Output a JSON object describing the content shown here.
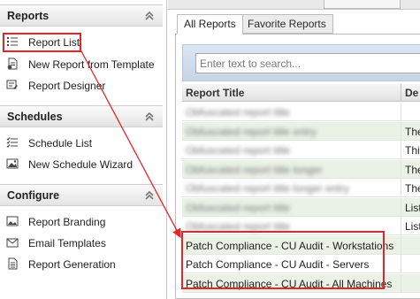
{
  "nav": {
    "sections": [
      {
        "title": "Reports",
        "items": [
          {
            "label": "Report List",
            "icon": "list-icon",
            "selected": true
          },
          {
            "label": "New Report from Template",
            "icon": "new-document-icon"
          },
          {
            "label": "Report Designer",
            "icon": "designer-icon"
          }
        ]
      },
      {
        "title": "Schedules",
        "items": [
          {
            "label": "Schedule List",
            "icon": "checklist-icon"
          },
          {
            "label": "New Schedule Wizard",
            "icon": "image-wizard-icon"
          }
        ]
      },
      {
        "title": "Configure",
        "items": [
          {
            "label": "Report Branding",
            "icon": "image-icon"
          },
          {
            "label": "Email Templates",
            "icon": "envelope-icon"
          },
          {
            "label": "Report Generation",
            "icon": "document-icon"
          }
        ]
      }
    ]
  },
  "tabs": [
    "All Reports",
    "Favorite Reports"
  ],
  "search": {
    "placeholder": "Enter text to search..."
  },
  "grid": {
    "columns": [
      "Report Title",
      "De"
    ],
    "rows": [
      {
        "title": "Obfuscated report title",
        "desc": "",
        "blurred": true
      },
      {
        "title": "Obfuscated report title entry",
        "desc": "The",
        "blurred": true
      },
      {
        "title": "Obfuscated report title",
        "desc": "Thi",
        "blurred": true
      },
      {
        "title": "Obfuscated report title longer",
        "desc": "The",
        "blurred": true
      },
      {
        "title": "Obfuscated report title longer entry",
        "desc": "The",
        "blurred": true
      },
      {
        "title": "Obfuscated report title",
        "desc": "List",
        "blurred": true
      },
      {
        "title": "Obfuscated report title",
        "desc": "List",
        "blurred": true
      },
      {
        "title": "Patch Compliance - CU Audit - Workstations",
        "desc": "",
        "blurred": false
      },
      {
        "title": "Patch Compliance - CU Audit - Servers",
        "desc": "",
        "blurred": false
      },
      {
        "title": "Patch Compliance - CU Audit - All Machines",
        "desc": "",
        "blurred": false
      }
    ]
  },
  "colors": {
    "annotation": "#e3262c",
    "row_alt": "#eaf2e6"
  }
}
